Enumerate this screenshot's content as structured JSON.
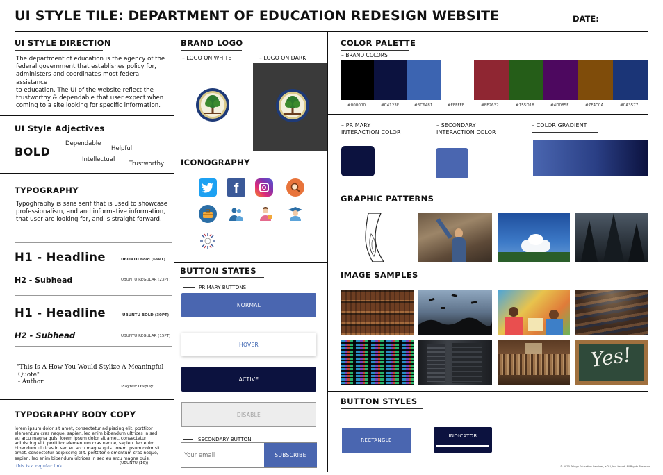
{
  "header": {
    "title": "UI STYLE TILE: DEPARTMENT OF EDUCATION REDESIGN WEBSITE",
    "date_label": "DATE:"
  },
  "direction": {
    "title": "UI STYLE DIRECTION",
    "lines": [
      "The department of education is the agency of the",
      "federal government that establishes policy for,",
      "administers and coordinates most federal assistance",
      "to education. The UI of the website reflect the",
      "trustworthy & dependable that user expect when",
      "coming to a site looking for specific information."
    ]
  },
  "adjectives": {
    "title": "UI Style Adjectives",
    "bold": "BOLD",
    "dependable": "Dependable",
    "helpful": "Helpful",
    "intellectual": "Intellectual",
    "trustworthy": "Trustworthy"
  },
  "typography": {
    "title": "TYPOGRAPHY",
    "lines": [
      "Typoghraphy is sans serif that is used to showcase",
      "professionalism, and and informative information,",
      "that user are looking for, and is straight forward."
    ],
    "h1_a": "H1 - Headline",
    "h1_a_spec": "UBUNTU Bold (66PT)",
    "h2_a": "H2 - Subhead",
    "h2_a_spec": "UBUNTU REGULAR (23PT)",
    "h1_b": "H1 - Headline",
    "h1_b_spec": "UBUNTU BOLD (30PT)",
    "h2_b": "H2 - Subhead",
    "h2_b_spec": "UBUNTU REGULAR (15PT)",
    "quote_line1": "\"This Is A How You Would Stylize A Meaningful",
    "quote_line2": "Quote\"",
    "quote_author": "- Author",
    "quote_font": "Playfair Display"
  },
  "body_copy": {
    "title": "TYPOGRAPHY BODY COPY",
    "lines": [
      "lorem ipsum dolor sit amet, consectetur adipiscing elit. porttitor",
      "elementum cras neque, sapien. leo enim bibendum ultrices in sed",
      "eu arcu magna quis. lorem ipsum dolor sit amet, consectetur",
      "adipiscing elit. porttitor elementum cras neque, sapien. leo enim",
      "bibendum ultrices in sed eu arcu magna quis. lorem ipsum dolor sit",
      "amet, consectetur adipiscing elit. porttitor elementum cras neque,",
      "sapien. leo enim bibendum ultrices in sed eu arcu magna quis."
    ],
    "spec": "(UBUNTU (16))",
    "link": "this is a regular link"
  },
  "brand_logo": {
    "title": "BRAND LOGO",
    "on_white": "LOGO ON WHITE",
    "on_dark": "LOGO ON DARK"
  },
  "iconography": {
    "title": "ICONOGRAPHY",
    "icons": [
      "twitter-icon",
      "facebook-icon",
      "instagram-icon",
      "search-icon",
      "briefcase-icon",
      "users-icon",
      "teacher-icon",
      "graduate-icon",
      "badge-icon"
    ]
  },
  "button_states": {
    "title": "BUTTON STATES",
    "primary_label": "PRIMARY BUTTONS",
    "normal": "NORMAL",
    "hover": "HOVER",
    "active": "ACTIVE",
    "disable": "DISABLE",
    "secondary_label": "SECONDARY BUTTON",
    "email_placeholder": "Your email",
    "subscribe": "SUBSCRIBE"
  },
  "palette": {
    "title": "COLOR PALETTE",
    "brand_label": "BRAND COLORS",
    "colors": [
      {
        "hex": "#000000",
        "label": "#000000"
      },
      {
        "hex": "#0C123F",
        "label": "#C4123F"
      },
      {
        "hex": "#3C64B1",
        "label": "#3C6481"
      },
      {
        "hex": "#FFFFFF",
        "label": "#FFFFFF"
      },
      {
        "hex": "#8F2632",
        "label": "#8F2632"
      },
      {
        "hex": "#255D18",
        "label": "#155D18"
      },
      {
        "hex": "#4D085F",
        "label": "#4D085F"
      },
      {
        "hex": "#7F4C0A",
        "label": "#7F4C0A"
      },
      {
        "hex": "#1B3577",
        "label": "#0A3577"
      }
    ],
    "primary_label_1": "PRIMARY",
    "primary_label_2": "INTERACTION COLOR",
    "primary_color": "#0C123F",
    "secondary_label_1": "SECONDARY",
    "secondary_label_2": "INTERACTION COLOR",
    "secondary_color": "#3C64B1",
    "gradient_label": "COLOR GRADIENT"
  },
  "patterns": {
    "title": "GRAPHIC PATTERNS"
  },
  "images": {
    "title": "IMAGE SAMPLES",
    "chalk_text": "Yes!"
  },
  "button_styles": {
    "title": "BUTTON STYLES",
    "rectangle": "RECTANGLE",
    "indicator": "INDICATOR"
  },
  "footer": {
    "copyright": "© 2020 Trilogy Education Services, a 2U, Inc. brand. All Rights Reserved."
  }
}
